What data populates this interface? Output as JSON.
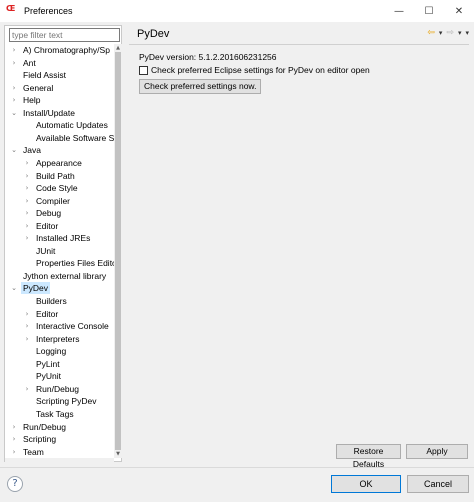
{
  "window": {
    "title": "Preferences",
    "minimize": "—",
    "maximize": "☐",
    "close": "✕"
  },
  "filter": {
    "placeholder": "type filter text"
  },
  "tree": [
    {
      "label": "A) Chromatography/Sp",
      "indent": 0,
      "arrow": "›"
    },
    {
      "label": "Ant",
      "indent": 0,
      "arrow": "›"
    },
    {
      "label": "Field Assist",
      "indent": 0,
      "arrow": ""
    },
    {
      "label": "General",
      "indent": 0,
      "arrow": "›"
    },
    {
      "label": "Help",
      "indent": 0,
      "arrow": "›"
    },
    {
      "label": "Install/Update",
      "indent": 0,
      "arrow": "⌄"
    },
    {
      "label": "Automatic Updates",
      "indent": 1,
      "arrow": ""
    },
    {
      "label": "Available Software S",
      "indent": 1,
      "arrow": ""
    },
    {
      "label": "Java",
      "indent": 0,
      "arrow": "⌄"
    },
    {
      "label": "Appearance",
      "indent": 1,
      "arrow": "›"
    },
    {
      "label": "Build Path",
      "indent": 1,
      "arrow": "›"
    },
    {
      "label": "Code Style",
      "indent": 1,
      "arrow": "›"
    },
    {
      "label": "Compiler",
      "indent": 1,
      "arrow": "›"
    },
    {
      "label": "Debug",
      "indent": 1,
      "arrow": "›"
    },
    {
      "label": "Editor",
      "indent": 1,
      "arrow": "›"
    },
    {
      "label": "Installed JREs",
      "indent": 1,
      "arrow": "›"
    },
    {
      "label": "JUnit",
      "indent": 1,
      "arrow": ""
    },
    {
      "label": "Properties Files Edito",
      "indent": 1,
      "arrow": ""
    },
    {
      "label": "Jython external library",
      "indent": 0,
      "arrow": ""
    },
    {
      "label": "PyDev",
      "indent": 0,
      "arrow": "⌄",
      "selected": true
    },
    {
      "label": "Builders",
      "indent": 1,
      "arrow": ""
    },
    {
      "label": "Editor",
      "indent": 1,
      "arrow": "›"
    },
    {
      "label": "Interactive Console",
      "indent": 1,
      "arrow": "›"
    },
    {
      "label": "Interpreters",
      "indent": 1,
      "arrow": "›"
    },
    {
      "label": "Logging",
      "indent": 1,
      "arrow": ""
    },
    {
      "label": "PyLint",
      "indent": 1,
      "arrow": ""
    },
    {
      "label": "PyUnit",
      "indent": 1,
      "arrow": ""
    },
    {
      "label": "Run/Debug",
      "indent": 1,
      "arrow": "›"
    },
    {
      "label": "Scripting PyDev",
      "indent": 1,
      "arrow": ""
    },
    {
      "label": "Task Tags",
      "indent": 1,
      "arrow": ""
    },
    {
      "label": "Run/Debug",
      "indent": 0,
      "arrow": "›"
    },
    {
      "label": "Scripting",
      "indent": 0,
      "arrow": "›"
    },
    {
      "label": "Team",
      "indent": 0,
      "arrow": "›"
    }
  ],
  "page": {
    "title": "PyDev",
    "version": "PyDev version: 5.1.2.201606231256",
    "checkbox_label": "Check preferred Eclipse settings for PyDev on editor open",
    "checkbox_checked": false,
    "check_button": "Check preferred settings now."
  },
  "nav": {
    "back": "⇦",
    "dropdown": "▾",
    "forward": "⇨",
    "menu": "▾"
  },
  "buttons": {
    "restore_defaults": "Restore Defaults",
    "apply": "Apply",
    "ok": "OK",
    "cancel": "Cancel",
    "help": "?"
  }
}
